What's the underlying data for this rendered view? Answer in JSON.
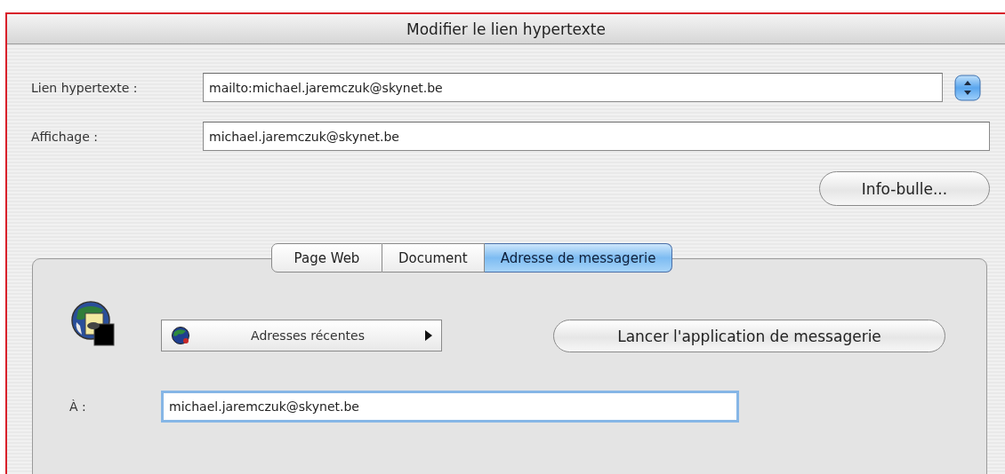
{
  "window": {
    "title": "Modifier le lien hypertexte"
  },
  "fields": [
    {
      "kind": "combo",
      "label": "Lien hypertexte :",
      "value": "mailto:michael.jaremczuk@skynet.be"
    },
    {
      "kind": "text",
      "label": "Affichage :",
      "value": "michael.jaremczuk@skynet.be"
    }
  ],
  "tooltip_button": "Info-bulle...",
  "tabs": [
    {
      "label": "Page Web",
      "selected": false
    },
    {
      "label": "Document",
      "selected": false
    },
    {
      "label": "Adresse de messagerie",
      "selected": true
    }
  ],
  "email_panel": {
    "recent_menu": "Adresses récentes",
    "launch_button": "Lancer l'application de messagerie",
    "to_label": "À :",
    "to_value": "michael.jaremczuk@skynet.be",
    "to_focused": true
  }
}
